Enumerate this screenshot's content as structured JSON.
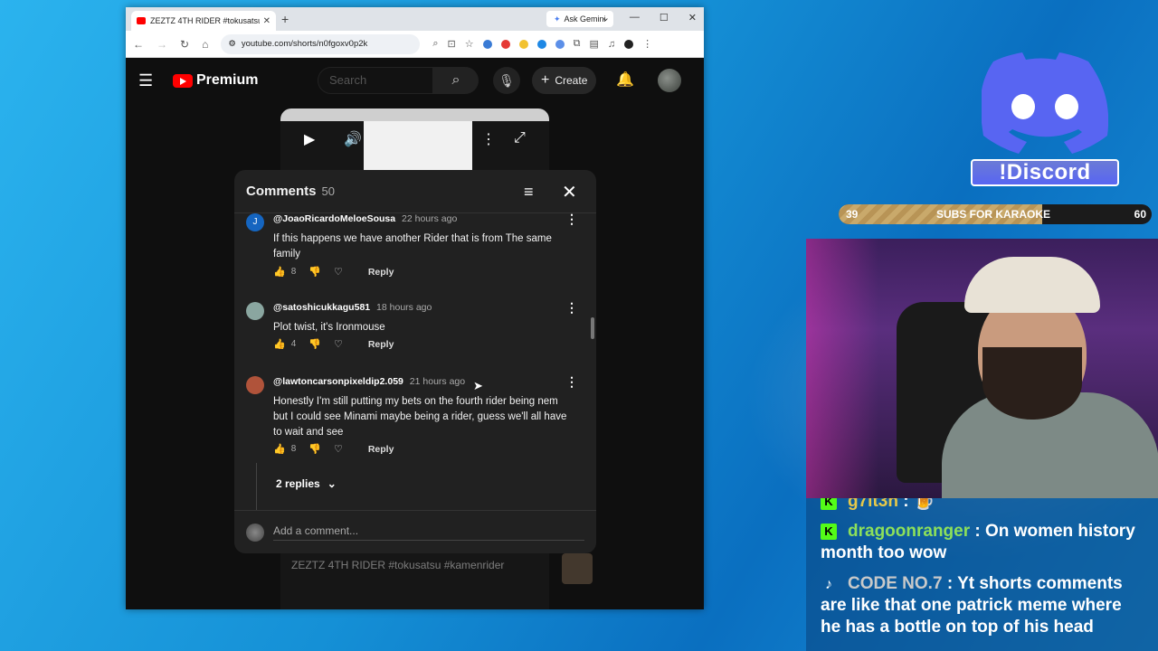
{
  "browser": {
    "tab_title": "ZEZTZ 4TH RIDER #tokusatsu #",
    "new_tab": "+",
    "ask_gemini": "Ask Gemini",
    "url": "youtube.com/shorts/n0fgoxv0p2k"
  },
  "youtube": {
    "brand": "Premium",
    "search_placeholder": "Search",
    "create_label": "Create",
    "short_title": "ZEZTZ 4TH RIDER #tokusatsu #kamenrider"
  },
  "comments_panel": {
    "title": "Comments",
    "count": "50",
    "add_placeholder": "Add a comment...",
    "items": [
      {
        "avatar_letter": "J",
        "author": "@JoaoRicardoMeloeSousa",
        "time": "22 hours ago",
        "text": "If this happens we have another Rider that is from The same family",
        "likes": "8",
        "reply": "Reply"
      },
      {
        "avatar_letter": "",
        "author": "@satoshicukkagu581",
        "time": "18 hours ago",
        "text": "Plot twist, it's Ironmouse",
        "likes": "4",
        "reply": "Reply"
      },
      {
        "avatar_letter": "",
        "author": "@lawtoncarsonpixeldip2.059",
        "time": "21 hours ago",
        "text": "Honestly I'm still putting my bets on the fourth rider being nem but I could see Minami maybe being a rider, guess we'll all have to wait and see",
        "likes": "8",
        "reply": "Reply"
      }
    ],
    "replies_label": "2 replies"
  },
  "overlay": {
    "discord_label": "!Discord",
    "subs": {
      "current": "39",
      "label": "SUBS FOR KARAOKE",
      "goal": "60",
      "progress": 0.65
    },
    "chat": [
      {
        "platform": "kick",
        "user": "g7lt3h",
        "sep": ":",
        "message": ""
      },
      {
        "platform": "kick",
        "user": "dragoonranger",
        "sep": ":",
        "message": "On women history month too wow"
      },
      {
        "platform": "tiktok",
        "user": "CODE NO.7",
        "sep": ":",
        "message": "Yt shorts comments are like that one patrick meme where he has a bottle on top of his head"
      }
    ]
  },
  "colors": {
    "yt_red": "#ff0000",
    "discord_blurple": "#5865f2",
    "kick_green": "#53fc18"
  }
}
